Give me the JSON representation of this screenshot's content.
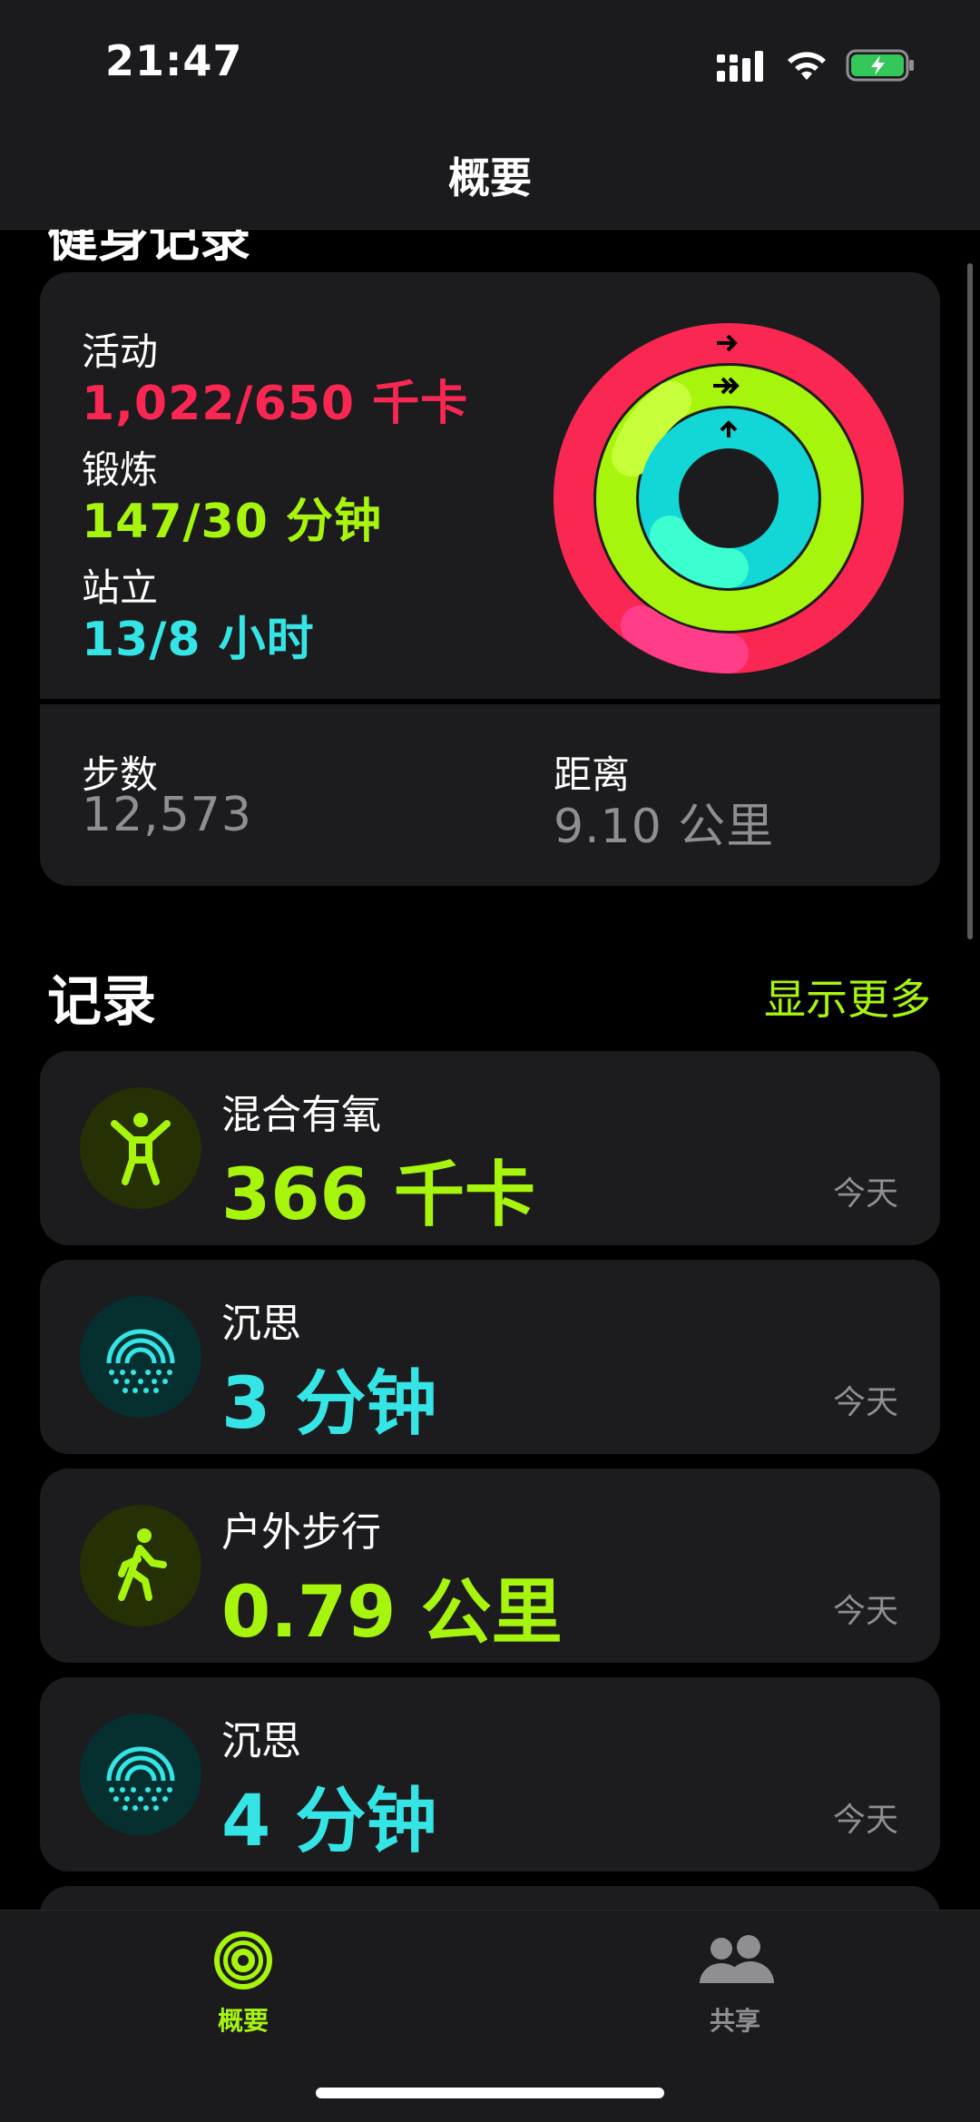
{
  "status_bar": {
    "time": "21:47"
  },
  "nav": {
    "title": "概要",
    "peek_text": "健身记录"
  },
  "summary": {
    "activity": {
      "label": "活动",
      "value": "1,022/650 千卡"
    },
    "exercise": {
      "label": "锻炼",
      "value": "147/30 分钟"
    },
    "stand": {
      "label": "站立",
      "value": "13/8 小时"
    },
    "steps": {
      "label": "步数",
      "value": "12,573"
    },
    "distance": {
      "label": "距离",
      "value": "9.10 公里"
    },
    "rings": {
      "move_progress": 1.57,
      "exercise_progress": 4.9,
      "stand_progress": 1.625
    }
  },
  "records": {
    "title": "记录",
    "show_more": "显示更多",
    "items": [
      {
        "title": "混合有氧",
        "value": "366 千卡",
        "date": "今天",
        "icon": "mixed-cardio-icon",
        "color": "#a7f50d"
      },
      {
        "title": "沉思",
        "value": "3 分钟",
        "date": "今天",
        "icon": "mindfulness-icon",
        "color": "#35e5e5"
      },
      {
        "title": "户外步行",
        "value": "0.79 公里",
        "date": "今天",
        "icon": "walking-icon",
        "color": "#a7f50d"
      },
      {
        "title": "沉思",
        "value": "4 分钟",
        "date": "今天",
        "icon": "mindfulness-icon",
        "color": "#35e5e5"
      }
    ]
  },
  "tabbar": {
    "tabs": [
      {
        "label": "概要",
        "icon": "activity-rings-icon",
        "active": true
      },
      {
        "label": "共享",
        "icon": "sharing-people-icon",
        "active": false
      }
    ]
  },
  "colors": {
    "move": "#fa2752",
    "exercise": "#a7f50d",
    "stand": "#35e5e5",
    "background": "#000000",
    "card": "#1c1c1e"
  }
}
